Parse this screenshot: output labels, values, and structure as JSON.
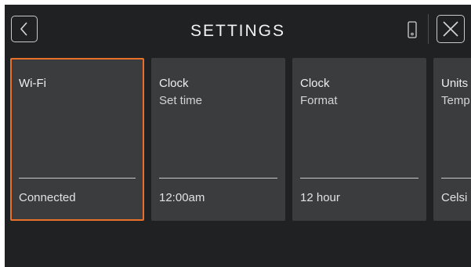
{
  "header": {
    "title": "SETTINGS",
    "back_icon": "chevron-left-icon",
    "device_icon": "phone-icon",
    "close_icon": "close-icon"
  },
  "accent_color": "#e8702a",
  "cards": [
    {
      "title": "Wi-Fi",
      "subtitle": "",
      "value": "Connected",
      "selected": true
    },
    {
      "title": "Clock",
      "subtitle": "Set time",
      "value": "12:00am",
      "selected": false
    },
    {
      "title": "Clock",
      "subtitle": "Format",
      "value": "12 hour",
      "selected": false
    },
    {
      "title": "Units",
      "subtitle": "Temp",
      "value": "Celsi",
      "selected": false
    }
  ]
}
